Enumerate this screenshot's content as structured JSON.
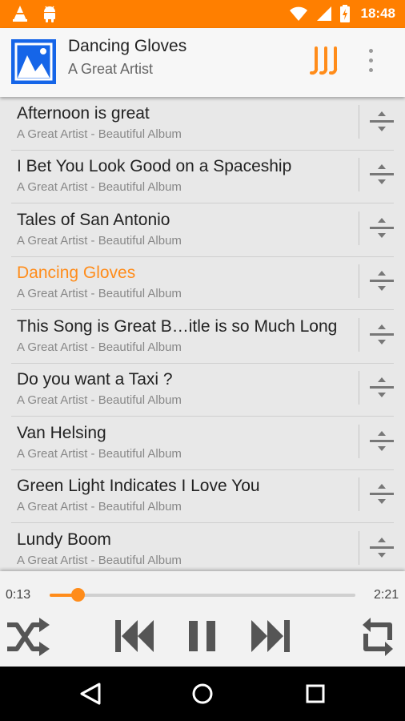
{
  "status_bar": {
    "time": "18:48",
    "left_icons": [
      "vlc-cone-icon",
      "android-icon"
    ],
    "right_icons": [
      "wifi-icon",
      "signal-icon",
      "battery-charging-icon"
    ]
  },
  "header": {
    "title": "Dancing Gloves",
    "artist": "A Great Artist",
    "album_art_icon": "image-placeholder-icon",
    "eq_icon": "equalizer-icon",
    "menu_icon": "more-vert-icon"
  },
  "songs": [
    {
      "title": "Afternoon is great",
      "subtitle": "A Great Artist - Beautiful Album",
      "playing": false
    },
    {
      "title": "I Bet You Look Good on a Spaceship",
      "subtitle": "A Great Artist - Beautiful Album",
      "playing": false
    },
    {
      "title": "Tales of San Antonio",
      "subtitle": "A Great Artist - Beautiful Album",
      "playing": false
    },
    {
      "title": "Dancing Gloves",
      "subtitle": "A Great Artist - Beautiful Album",
      "playing": true
    },
    {
      "title": "This Song is Great B…itle is so Much Long",
      "subtitle": "A Great Artist - Beautiful Album",
      "playing": false
    },
    {
      "title": "Do you want a Taxi ?",
      "subtitle": "A Great Artist - Beautiful Album",
      "playing": false
    },
    {
      "title": "Van Helsing",
      "subtitle": "A Great Artist - Beautiful Album",
      "playing": false
    },
    {
      "title": "Green Light Indicates I Love You",
      "subtitle": "A Great Artist - Beautiful Album",
      "playing": false
    },
    {
      "title": "Lundy Boom",
      "subtitle": "A Great Artist - Beautiful Album",
      "playing": false
    }
  ],
  "player": {
    "elapsed": "0:13",
    "total": "2:21",
    "progress": 0.092,
    "controls": [
      "shuffle-icon",
      "skip-previous-icon",
      "pause-icon",
      "skip-next-icon",
      "repeat-icon"
    ]
  },
  "nav_bar": {
    "buttons": [
      "back-icon",
      "home-icon",
      "recents-icon"
    ]
  },
  "colors": {
    "accent": "#ff8c1a",
    "status_bar": "#ff7f00",
    "album_art": "#1565e8"
  }
}
